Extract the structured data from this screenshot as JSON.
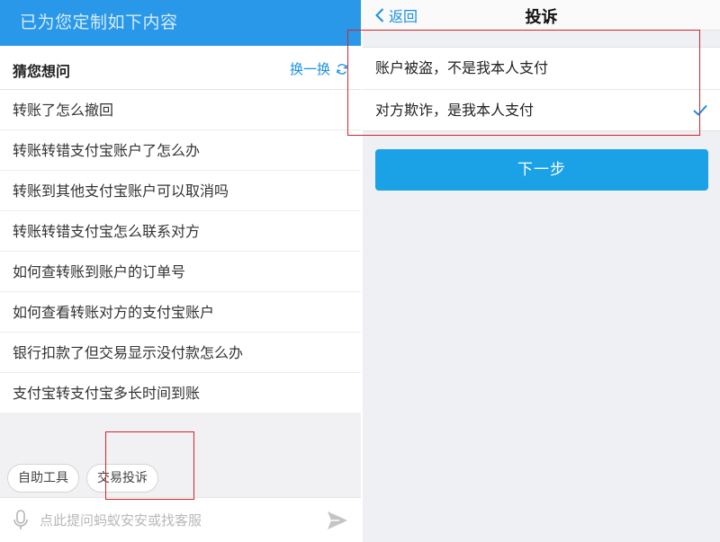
{
  "left": {
    "banner_text": "已为您定制如下内容",
    "guess_title": "猜您想问",
    "refresh_label": "换一换",
    "questions": [
      "转账了怎么撤回",
      "转账转错支付宝账户了怎么办",
      "转账到其他支付宝账户可以取消吗",
      "转账转错支付宝怎么联系对方",
      "如何查转账到账户的订单号",
      "如何查看转账对方的支付宝账户",
      "银行扣款了但交易显示没付款怎么办",
      "支付宝转支付宝多长时间到账"
    ],
    "tools": [
      "自助工具",
      "交易投诉"
    ],
    "input_placeholder": "点此提问蚂蚁安安或找客服"
  },
  "right": {
    "back_label": "返回",
    "title": "投诉",
    "options": [
      {
        "label": "账户被盗，不是我本人支付",
        "selected": false
      },
      {
        "label": "对方欺诈，是我本人支付",
        "selected": true
      }
    ],
    "next_label": "下一步"
  },
  "icons": {
    "refresh": "refresh-icon",
    "mic": "microphone-icon",
    "send": "send-icon",
    "back": "chevron-left-icon",
    "check": "check-icon"
  },
  "colors": {
    "banner": "#2a98e8",
    "link": "#1a8fe3",
    "primary_button": "#1aa1e6",
    "highlight_box": "#d3242b"
  }
}
